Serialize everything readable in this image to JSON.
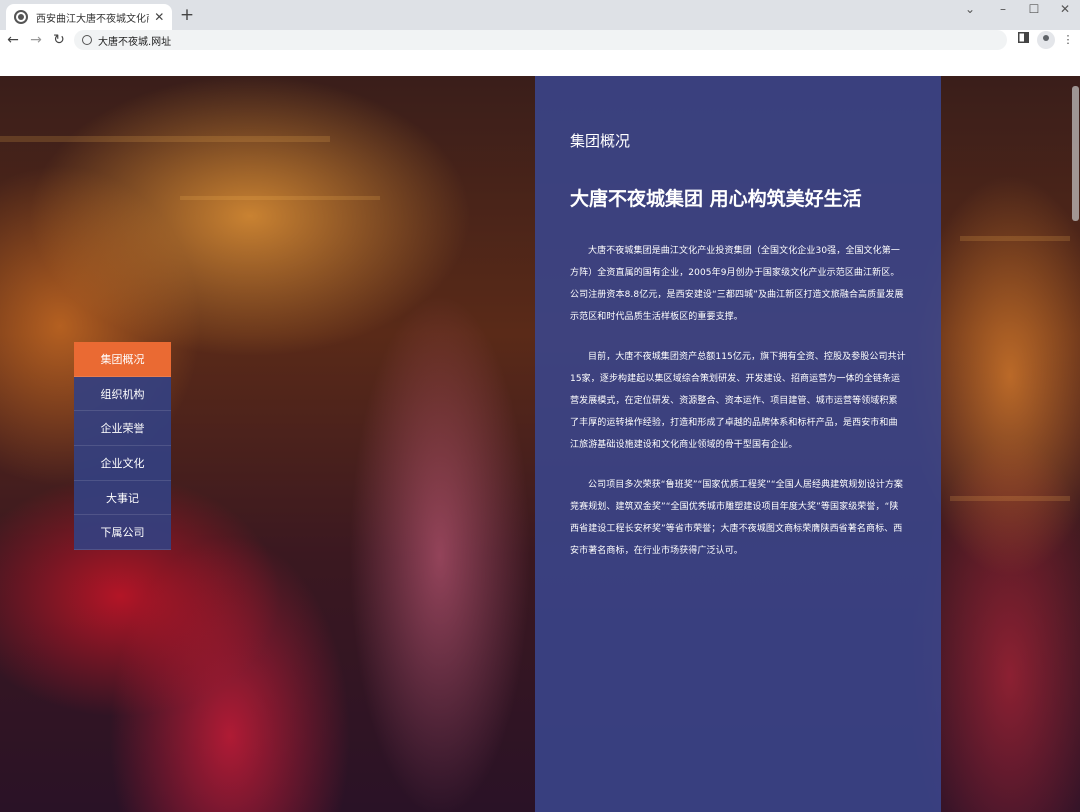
{
  "browser": {
    "tab_title": "西安曲江大唐不夜城文化商业（集",
    "tab_close": "✕",
    "new_tab": "+",
    "url": "大唐不夜城.网址",
    "window_controls": {
      "chevron": "⌄",
      "minimize": "–",
      "maximize": "☐",
      "close": "✕"
    },
    "nav": {
      "back": "←",
      "forward": "→",
      "reload": "↻"
    },
    "menu": "⋮"
  },
  "page": {
    "section_title": "集团概况",
    "headline": "大唐不夜城集团 用心构筑美好生活",
    "paragraphs": [
      "大唐不夜城集团是曲江文化产业投资集团（全国文化企业30强，全国文化第一方阵）全资直属的国有企业，2005年9月创办于国家级文化产业示范区曲江新区。公司注册资本8.8亿元，是西安建设“三都四城”及曲江新区打造文旅融合高质量发展示范区和时代品质生活样板区的重要支撑。",
      "目前，大唐不夜城集团资产总额115亿元，旗下拥有全资、控股及参股公司共计15家，逐步构建起以集区域综合策划研发、开发建设、招商运营为一体的全链条运营发展模式，在定位研发、资源整合、资本运作、项目建管、城市运营等领域积累了丰厚的运转操作经验，打造和形成了卓越的品牌体系和标杆产品，是西安市和曲江旅游基础设施建设和文化商业领域的骨干型国有企业。",
      "公司项目多次荣获“鲁班奖”“国家优质工程奖”“全国人居经典建筑规划设计方案竞赛规划、建筑双金奖”“全国优秀城市雕塑建设项目年度大奖”等国家级荣誉，“陕西省建设工程长安杯奖”等省市荣誉；大唐不夜城图文商标荣膺陕西省著名商标、西安市著名商标，在行业市场获得广泛认可。"
    ]
  },
  "side_nav": {
    "items": [
      {
        "label": "集团概况",
        "active": true
      },
      {
        "label": "组织机构",
        "active": false
      },
      {
        "label": "企业荣誉",
        "active": false
      },
      {
        "label": "企业文化",
        "active": false
      },
      {
        "label": "大事记",
        "active": false
      },
      {
        "label": "下属公司",
        "active": false
      }
    ]
  },
  "colors": {
    "accent": "#ea6a33",
    "panel": "#3a468c",
    "nav_item": "#344080"
  }
}
